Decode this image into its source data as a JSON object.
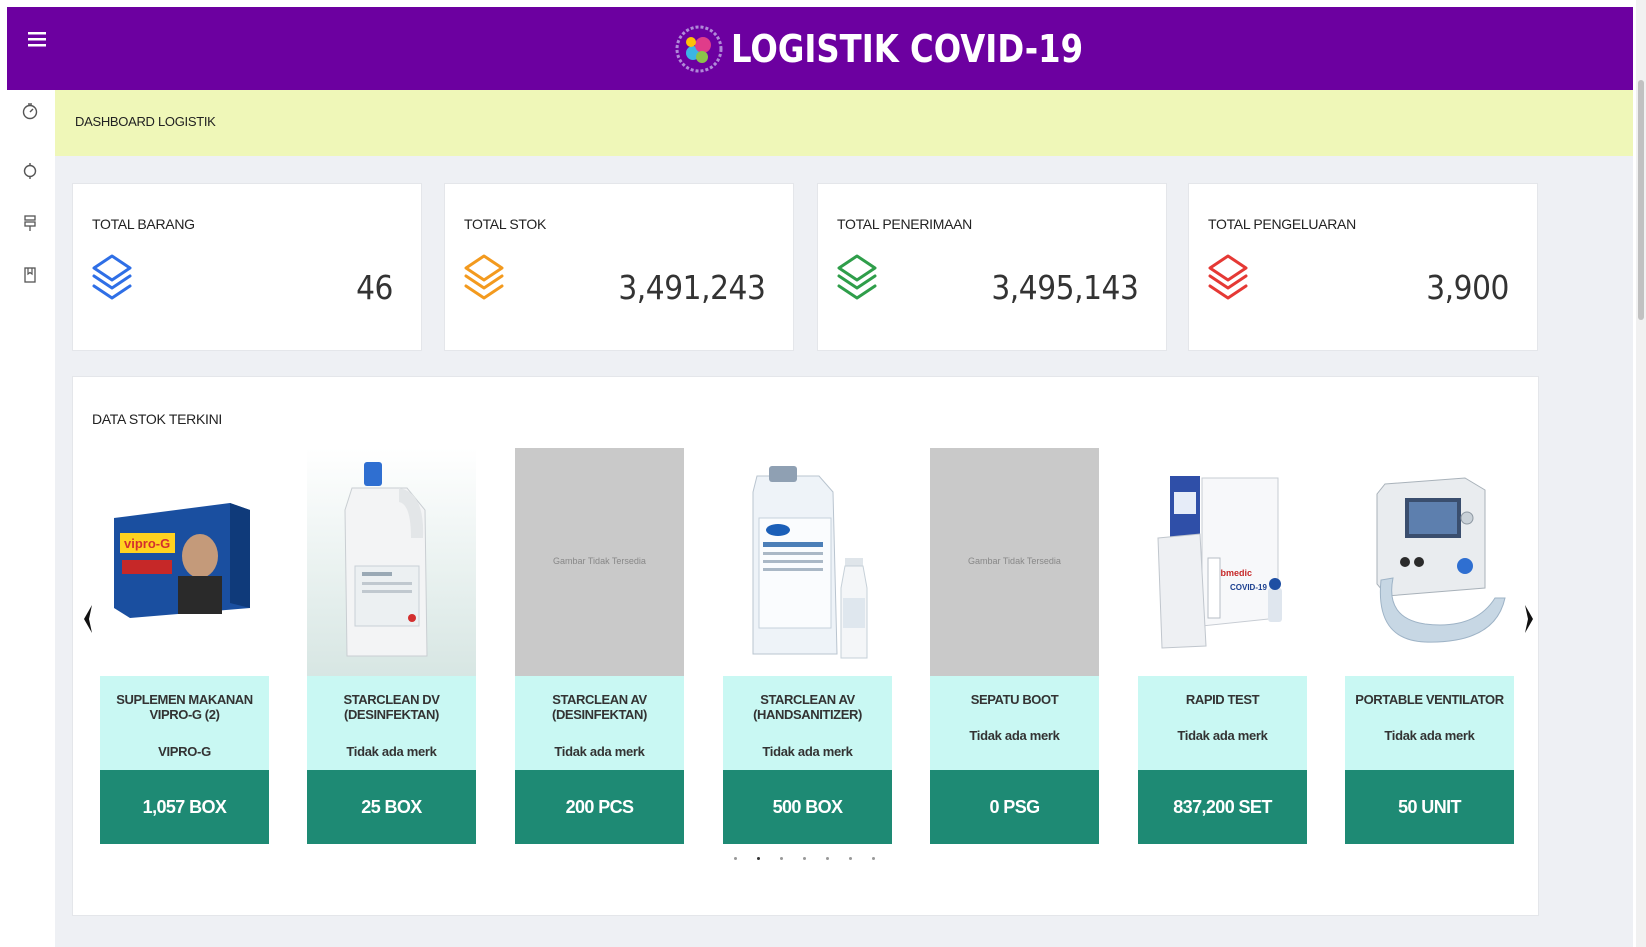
{
  "header": {
    "title": "LOGISTIK COVID-19",
    "brand_color": "#6c00a0",
    "menu_icon": "hamburger-icon"
  },
  "sidebar": {
    "items": [
      {
        "name": "dashboard",
        "icon": "speedometer-icon"
      },
      {
        "name": "target",
        "icon": "target-icon"
      },
      {
        "name": "signpost",
        "icon": "signpost-icon"
      },
      {
        "name": "report",
        "icon": "book-icon"
      }
    ]
  },
  "breadcrumb": {
    "label": "DASHBOARD LOGISTIK"
  },
  "stats": [
    {
      "label": "TOTAL BARANG",
      "value": "46",
      "color": "#2f6fe6"
    },
    {
      "label": "TOTAL STOK",
      "value": "3,491,243",
      "color": "#f39a1e"
    },
    {
      "label": "TOTAL PENERIMAAN",
      "value": "3,495,143",
      "color": "#2f9e4a"
    },
    {
      "label": "TOTAL PENGELUARAN",
      "value": "3,900",
      "color": "#e53935"
    }
  ],
  "stock_panel": {
    "title": "DATA STOK TERKINI",
    "no_image_text": "Gambar Tidak Tersedia",
    "items": [
      {
        "name": "SUPLEMEN MAKANAN VIPRO-G (2)",
        "brand": "VIPRO-G",
        "qty": "1,057 BOX",
        "image": "vipro-g-box"
      },
      {
        "name": "STARCLEAN DV (DESINFEKTAN)",
        "brand": "Tidak ada merk",
        "qty": "25 BOX",
        "image": "jerrycan"
      },
      {
        "name": "STARCLEAN AV (DESINFEKTAN)",
        "brand": "Tidak ada merk",
        "qty": "200 PCS",
        "image": "none"
      },
      {
        "name": "STARCLEAN AV (HANDSANITIZER)",
        "brand": "Tidak ada merk",
        "qty": "500 BOX",
        "image": "sanitizer"
      },
      {
        "name": "SEPATU BOOT",
        "brand": "Tidak ada merk",
        "qty": "0 PSG",
        "image": "none"
      },
      {
        "name": "RAPID TEST",
        "brand": "Tidak ada merk",
        "qty": "837,200 SET",
        "image": "rapid-test-kit"
      },
      {
        "name": "PORTABLE VENTILATOR",
        "brand": "Tidak ada merk",
        "qty": "50 UNIT",
        "image": "ventilator"
      }
    ],
    "carousel_pages": 7,
    "active_page": 1
  }
}
